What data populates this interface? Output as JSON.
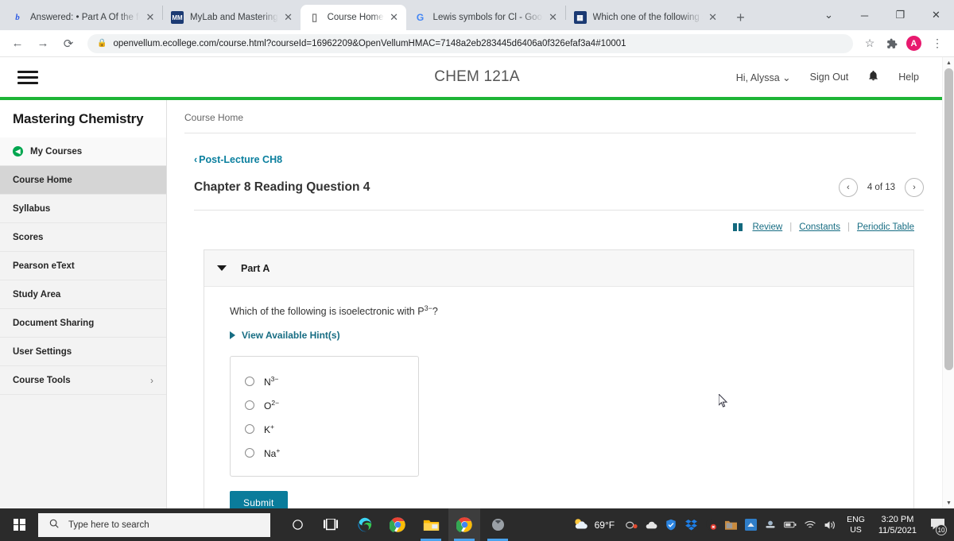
{
  "browser": {
    "tabs": [
      {
        "title": "Answered: • Part A Of the fol",
        "favicon": "b",
        "favicon_bg": "#ffffff",
        "favicon_color": "#2d5be3",
        "active": false
      },
      {
        "title": "MyLab and Mastering",
        "favicon": "▒",
        "favicon_bg": "#1b3a73",
        "favicon_color": "#ffffff",
        "active": false
      },
      {
        "title": "Course Home",
        "favicon": "▯",
        "favicon_bg": "#ffffff",
        "favicon_color": "#6b6b6b",
        "active": true
      },
      {
        "title": "Lewis symbols for Cl - Googl",
        "favicon": "G",
        "favicon_bg": "#ffffff",
        "favicon_color": "#4285f4",
        "active": false
      },
      {
        "title": "Which one of the following s",
        "favicon": "▤",
        "favicon_bg": "#1b3a73",
        "favicon_color": "#ffffff",
        "active": false
      }
    ],
    "new_tab_label": "+",
    "tab_close_label": "✕",
    "window_controls": {
      "tab_search": "⌄",
      "minimize": "─",
      "maximize": "❐",
      "close": "✕"
    },
    "toolbar": {
      "back": "←",
      "forward": "→",
      "reload": "⟳",
      "lock_icon": "🔒",
      "url": "openvellum.ecollege.com/course.html?courseId=16962209&OpenVellumHMAC=7148a2eb283445d6406a0f326efaf3a4#10001",
      "bookmark_star": "☆",
      "extensions_icon": "🧩",
      "profile_initial": "A",
      "menu_icon": "⋮"
    }
  },
  "mastering": {
    "hamburger_label": "menu",
    "course_title": "CHEM 121A",
    "greeting": "Hi, Alyssa",
    "greeting_caret": "⌄",
    "sign_out": "Sign Out",
    "notifications_icon": "🔔",
    "help": "Help",
    "accent_green": "#1db436"
  },
  "sidebar": {
    "title": "Mastering Chemistry",
    "items": [
      {
        "label": "My Courses",
        "icon": "back-circle-icon",
        "active": false,
        "has_chevron": false
      },
      {
        "label": "Course Home",
        "active": true,
        "has_chevron": false
      },
      {
        "label": "Syllabus",
        "active": false,
        "has_chevron": false
      },
      {
        "label": "Scores",
        "active": false,
        "has_chevron": false
      },
      {
        "label": "Pearson eText",
        "active": false,
        "has_chevron": false
      },
      {
        "label": "Study Area",
        "active": false,
        "has_chevron": false
      },
      {
        "label": "Document Sharing",
        "active": false,
        "has_chevron": false
      },
      {
        "label": "User Settings",
        "active": false,
        "has_chevron": false
      },
      {
        "label": "Course Tools",
        "active": false,
        "has_chevron": true,
        "chevron": "›"
      }
    ]
  },
  "main": {
    "breadcrumb": "Course Home",
    "back_link": "Post-Lecture CH8",
    "back_chevron": "‹",
    "question_title": "Chapter 8 Reading Question 4",
    "pager": {
      "prev": "‹",
      "next": "›",
      "label": "4 of 13"
    },
    "tool_links": {
      "review": "Review",
      "constants": "Constants",
      "periodic_table": "Periodic Table",
      "divider": "|"
    },
    "part": {
      "label": "Part A",
      "question_prefix": "Which of the following is isoelectronic with P",
      "question_sup": "3−",
      "question_suffix": "?",
      "hints_label": "View Available Hint(s)",
      "choices": [
        {
          "base": "N",
          "sup": "3−",
          "selected": false
        },
        {
          "base": "O",
          "sup": "2−",
          "selected": false
        },
        {
          "base": "K",
          "sup": "+",
          "selected": false
        },
        {
          "base": "Na",
          "sup": "+",
          "selected": false
        }
      ],
      "submit_label": "Submit"
    }
  },
  "taskbar": {
    "search_placeholder": "Type here to search",
    "search_icon": "🔍",
    "items": [
      {
        "name": "cortana-icon",
        "glyph": "○",
        "active": false,
        "underline": false
      },
      {
        "name": "task-view-icon",
        "glyph": "⌸",
        "active": false,
        "underline": false
      },
      {
        "name": "microsoft-edge-icon",
        "glyph": "e",
        "active": false,
        "underline": false
      },
      {
        "name": "google-chrome-icon",
        "glyph": "",
        "active": false,
        "underline": false
      },
      {
        "name": "file-explorer-icon",
        "glyph": "",
        "active": false,
        "underline": true
      },
      {
        "name": "google-chrome-window-icon",
        "glyph": "",
        "active": true,
        "underline": true
      },
      {
        "name": "xbox-game-bar-icon",
        "glyph": "⌘",
        "active": false,
        "underline": true
      }
    ],
    "weather": {
      "temperature": "69°F",
      "icon": "partly-cloudy-icon"
    },
    "tray_icons": [
      "camera-icon",
      "onedrive-icon",
      "security-shield-icon",
      "dropbox-icon",
      "antivirus-icon",
      "folder-sync-icon",
      "update-icon",
      "mouse-icon",
      "battery-icon",
      "wifi-icon",
      "volume-icon"
    ],
    "language": {
      "line1": "ENG",
      "line2": "US"
    },
    "clock": {
      "time": "3:20 PM",
      "date": "11/5/2021"
    },
    "notification_count": "10"
  }
}
